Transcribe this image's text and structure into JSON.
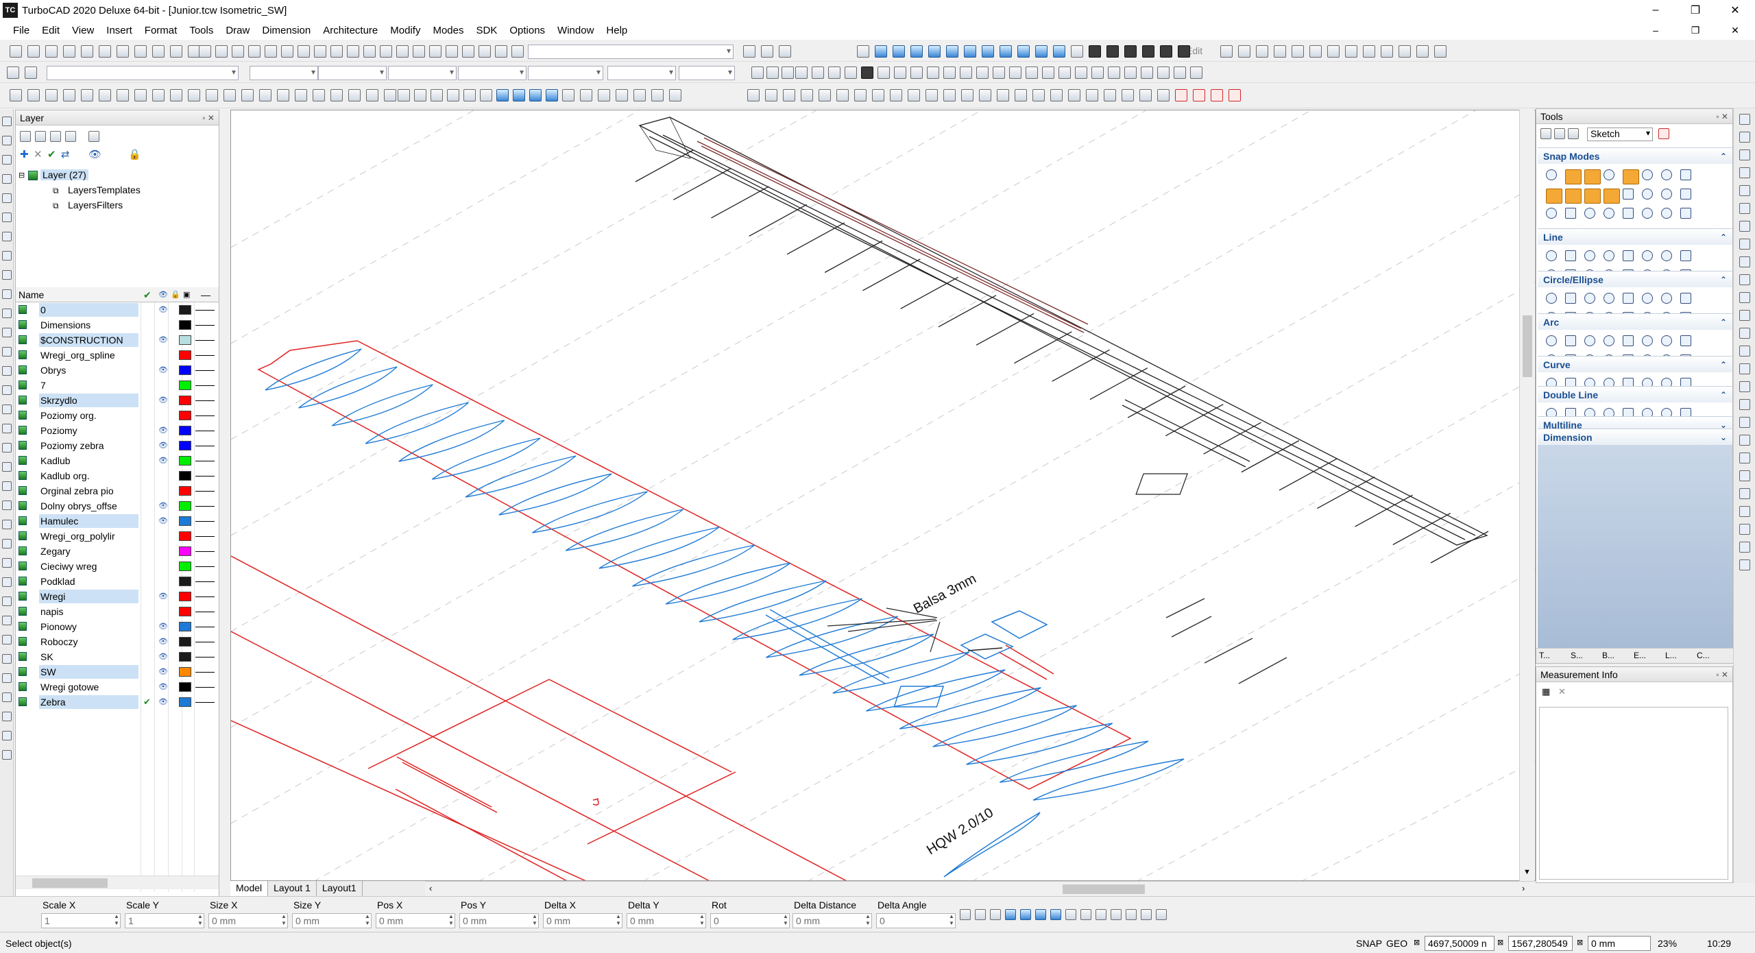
{
  "window": {
    "app_icon": "TC",
    "title": "TurboCAD 2020 Deluxe 64-bit - [Junior.tcw Isometric_SW]",
    "controls": [
      "–",
      "❐",
      "✕"
    ]
  },
  "menu": {
    "items": [
      "File",
      "Edit",
      "View",
      "Insert",
      "Format",
      "Tools",
      "Draw",
      "Dimension",
      "Architecture",
      "Modify",
      "Modes",
      "SDK",
      "Options",
      "Window",
      "Help"
    ],
    "doc_controls": [
      "–",
      "❐",
      "✕"
    ]
  },
  "toolbar": {
    "edit_label": "Edit"
  },
  "layer_panel": {
    "title": "Layer",
    "tree": {
      "root": "Layer (27)",
      "children": [
        "LayersTemplates",
        "LayersFilters"
      ]
    },
    "columns": {
      "name": "Name"
    },
    "layers": [
      {
        "name": "0",
        "color": "#1a1a1a",
        "visible": true,
        "selected": true
      },
      {
        "name": "Dimensions",
        "color": "#000000",
        "visible": false,
        "selected": false
      },
      {
        "name": "$CONSTRUCTION",
        "color": "#b7dfe0",
        "visible": true,
        "selected": true
      },
      {
        "name": "Wregi_org_spline",
        "color": "#ff0000",
        "visible": false,
        "selected": false
      },
      {
        "name": "Obrys",
        "color": "#0000ff",
        "visible": true,
        "selected": false
      },
      {
        "name": "7",
        "color": "#00ee00",
        "visible": false,
        "selected": false
      },
      {
        "name": "Skrzydlo",
        "color": "#ff0000",
        "visible": true,
        "selected": true
      },
      {
        "name": "Poziomy org.",
        "color": "#ff0000",
        "visible": false,
        "selected": false
      },
      {
        "name": "Poziomy",
        "color": "#0000ff",
        "visible": true,
        "selected": false
      },
      {
        "name": "Poziomy zebra",
        "color": "#0000ff",
        "visible": true,
        "selected": false
      },
      {
        "name": "Kadlub",
        "color": "#00ee00",
        "visible": true,
        "selected": false
      },
      {
        "name": "Kadlub org.",
        "color": "#000000",
        "visible": false,
        "selected": false
      },
      {
        "name": "Orginal zebra pio",
        "color": "#ff0000",
        "visible": false,
        "selected": false
      },
      {
        "name": "Dolny obrys_offse",
        "color": "#00ee00",
        "visible": true,
        "selected": false
      },
      {
        "name": "Hamulec",
        "color": "#1e7ad6",
        "visible": true,
        "selected": true
      },
      {
        "name": "Wregi_org_polylir",
        "color": "#ff0000",
        "visible": false,
        "selected": false
      },
      {
        "name": "Zegary",
        "color": "#ff00ff",
        "visible": false,
        "selected": false
      },
      {
        "name": "Cieciwy wreg",
        "color": "#00ee00",
        "visible": false,
        "selected": false
      },
      {
        "name": "Podklad",
        "color": "#1a1a1a",
        "visible": false,
        "selected": false
      },
      {
        "name": "Wregi",
        "color": "#ff0000",
        "visible": true,
        "selected": true
      },
      {
        "name": "napis",
        "color": "#ff0000",
        "visible": false,
        "selected": false
      },
      {
        "name": "Pionowy",
        "color": "#1e7ad6",
        "visible": true,
        "selected": false
      },
      {
        "name": "Roboczy",
        "color": "#1a1a1a",
        "visible": true,
        "selected": false
      },
      {
        "name": "SK",
        "color": "#1a1a1a",
        "visible": true,
        "selected": false
      },
      {
        "name": "SW",
        "color": "#ff8800",
        "visible": true,
        "selected": true
      },
      {
        "name": "Wregi gotowe",
        "color": "#000000",
        "visible": true,
        "selected": false
      },
      {
        "name": "Zebra",
        "color": "#1e7ad6",
        "visible": true,
        "selected": true,
        "current": true
      }
    ]
  },
  "drawing": {
    "annotation_balsa": "Balsa 3mm",
    "annotation_profile": "HQW 2.0/10"
  },
  "tabs": [
    "Model",
    "Layout 1",
    "Layout1"
  ],
  "tools_panel": {
    "title": "Tools",
    "mode_select": "Sketch",
    "sections": [
      "Snap Modes",
      "Line",
      "Circle/Ellipse",
      "Arc",
      "Curve",
      "Double Line",
      "Multiline",
      "Dimension"
    ],
    "bottom_tabs": [
      "T...",
      "S...",
      "B...",
      "E...",
      "L...",
      "C..."
    ]
  },
  "measurement_panel": {
    "title": "Measurement Info"
  },
  "coord_fields": [
    {
      "label": "Scale X",
      "value": "1"
    },
    {
      "label": "Scale Y",
      "value": "1"
    },
    {
      "label": "Size X",
      "value": "0 mm"
    },
    {
      "label": "Size Y",
      "value": "0 mm"
    },
    {
      "label": "Pos X",
      "value": "0 mm"
    },
    {
      "label": "Pos Y",
      "value": "0 mm"
    },
    {
      "label": "Delta X",
      "value": "0 mm"
    },
    {
      "label": "Delta Y",
      "value": "0 mm"
    },
    {
      "label": "Rot",
      "value": "0"
    },
    {
      "label": "Delta Distance",
      "value": "0 mm"
    },
    {
      "label": "Delta Angle",
      "value": "0"
    }
  ],
  "status": {
    "message": "Select object(s)",
    "snap": "SNAP",
    "geo": "GEO",
    "x": "4697,50009 n",
    "y": "1567,280549",
    "z": "0 mm",
    "zoom": "23%",
    "time": "10:29"
  }
}
